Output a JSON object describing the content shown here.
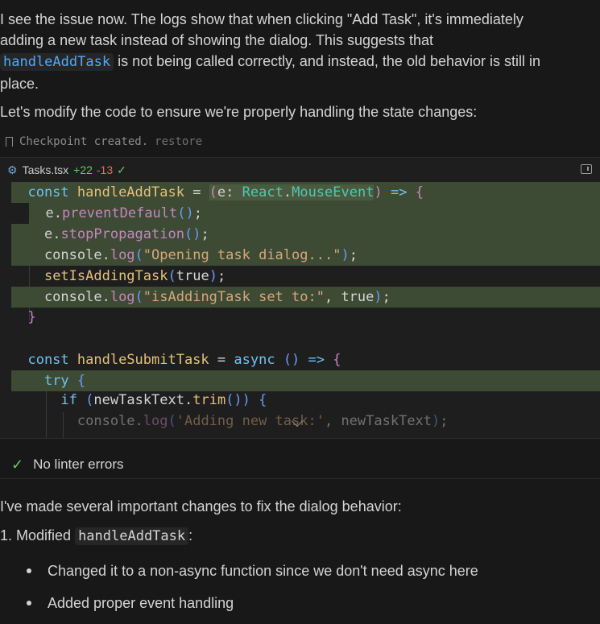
{
  "message": {
    "para1_line1": "I see the issue now. The logs show that when clicking \"Add Task\", it's immediately",
    "para1_line2": "adding a new task instead of showing the dialog. This suggests that",
    "para1_code": "handleAddTask",
    "para1_line3_rest": " is not being called correctly, and instead, the old behavior is still in",
    "para1_line4": "place.",
    "para2": "Let's modify the code to ensure we're properly handling the state changes:"
  },
  "checkpoint": {
    "text": "Checkpoint created.",
    "restore_label": "restore"
  },
  "codeblock": {
    "filename": "Tasks.tsx",
    "additions": "+22",
    "deletions": "-13",
    "icon": "gear-icon",
    "lines": [
      "const handleAddTask = (e: React.MouseEvent) => {",
      "  e.preventDefault();",
      "  e.stopPropagation();",
      "  console.log(\"Opening task dialog...\");",
      "  setIsAddingTask(true);",
      "  console.log(\"isAddingTask set to:\", true);",
      "}",
      "",
      "const handleSubmitTask = async () => {",
      "  try {",
      "    if (newTaskText.trim()) {",
      "      console.log('Adding new task:', newTaskText);"
    ],
    "added_lines": [
      0,
      1,
      2,
      3,
      5,
      9
    ]
  },
  "lint": {
    "text": "No linter errors"
  },
  "summary": {
    "intro": "I've made several important changes to fix the dialog behavior:",
    "item1_prefix": "1. Modified ",
    "item1_code": "handleAddTask",
    "item1_suffix": ":",
    "bullets": [
      "Changed it to a non-async function since we don't need async here",
      "Added proper event handling"
    ]
  },
  "colors": {
    "added_bg": "#3d4a34",
    "link": "#4daafc",
    "added_count": "#6cc46c",
    "deleted_count": "#e06c6c"
  }
}
